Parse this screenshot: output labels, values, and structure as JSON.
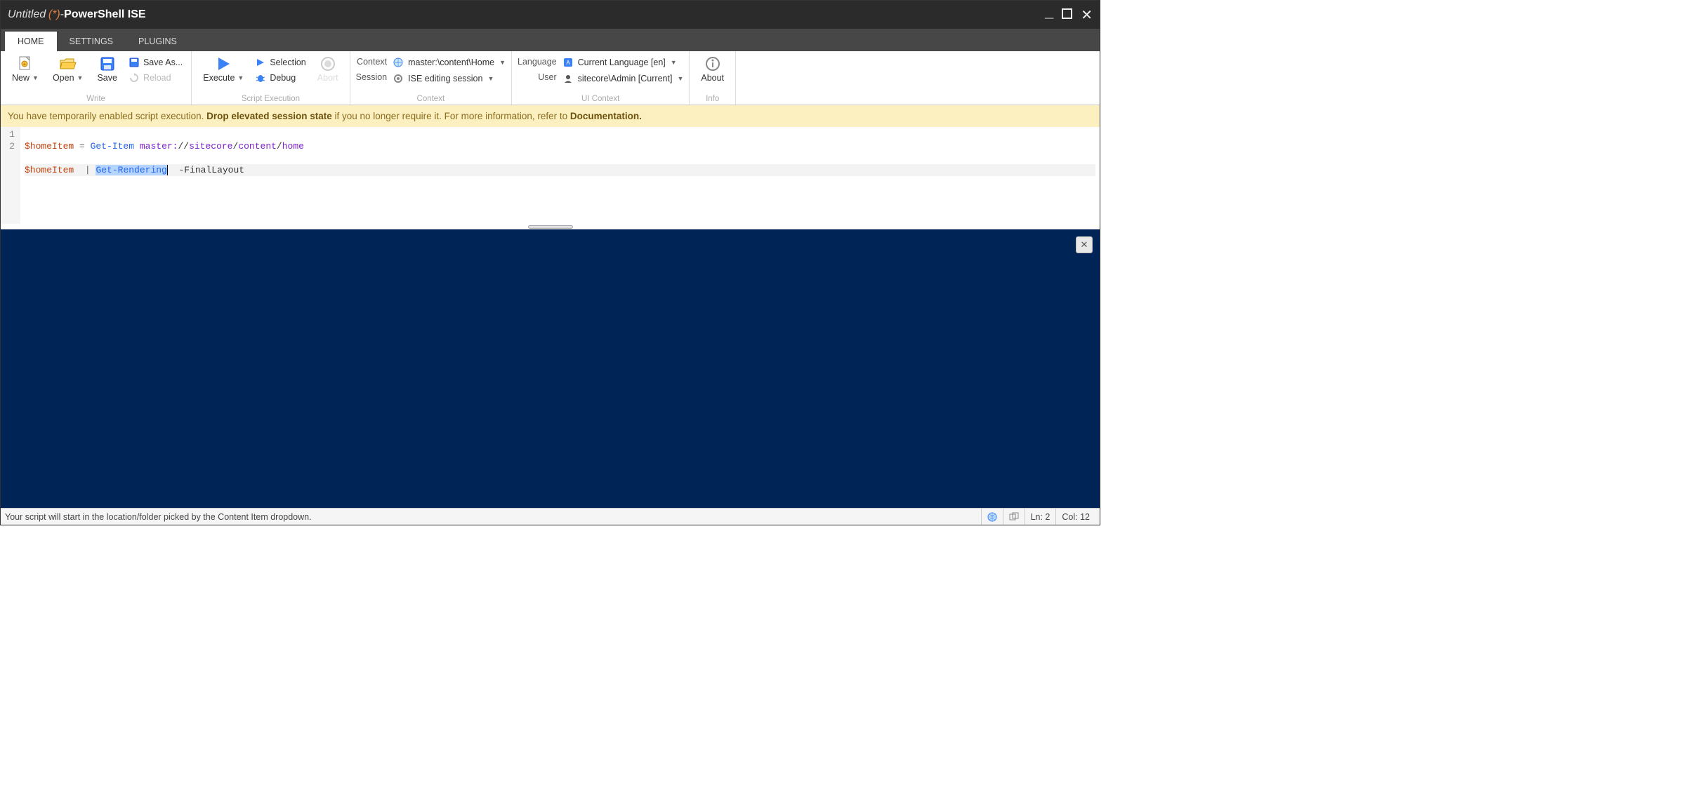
{
  "title": {
    "untitled": "Untitled",
    "modified": "(*)",
    "dash": " - ",
    "app": "PowerShell ISE"
  },
  "tabs": {
    "home": "HOME",
    "settings": "SETTINGS",
    "plugins": "PLUGINS"
  },
  "ribbon": {
    "write": {
      "new": "New",
      "open": "Open",
      "save": "Save",
      "save_as": "Save As...",
      "reload": "Reload",
      "group": "Write"
    },
    "exec": {
      "execute": "Execute",
      "selection": "Selection",
      "debug": "Debug",
      "abort": "Abort",
      "group": "Script Execution"
    },
    "context": {
      "context_lbl": "Context",
      "session_lbl": "Session",
      "context_val": "master:\\content\\Home",
      "session_val": "ISE editing session",
      "group": "Context"
    },
    "uicontext": {
      "language_lbl": "Language",
      "user_lbl": "User",
      "language_val": "Current Language [en]",
      "user_val": "sitecore\\Admin [Current]",
      "group": "UI Context"
    },
    "info": {
      "about": "About",
      "group": "Info"
    }
  },
  "banner": {
    "p1": "You have temporarily enabled script execution. ",
    "b1": "Drop elevated session state",
    "p2": " if you no longer require it. For more information, refer to ",
    "b2": "Documentation.",
    "p3": ""
  },
  "code": {
    "line1": {
      "var": "$homeItem",
      "eq": " = ",
      "cmd": "Get-Item",
      "sp": " ",
      "arg1": "master:",
      "arg2": "//",
      "arg3": "sitecore",
      "arg4": "/",
      "arg5": "content",
      "arg6": "/",
      "arg7": "home"
    },
    "line2": {
      "var": "$homeItem",
      "pipe": "  | ",
      "cmd": "Get-Rendering",
      "sp": "  ",
      "param": "-FinalLayout"
    },
    "gutter": [
      "1",
      "2"
    ]
  },
  "status": {
    "msg": "Your script will start in the location/folder picked by the Content Item dropdown.",
    "ln": "Ln: 2",
    "col": "Col: 12"
  }
}
